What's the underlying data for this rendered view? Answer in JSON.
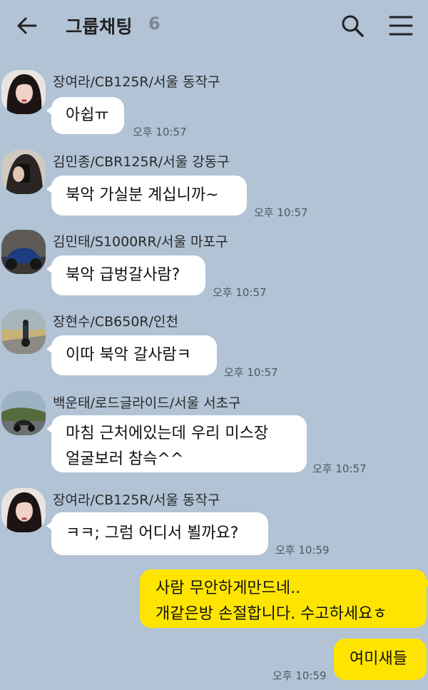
{
  "header": {
    "title": "그룹채팅",
    "member_count": "6",
    "back_icon": "back-arrow-icon",
    "search_icon": "search-icon",
    "menu_icon": "hamburger-menu-icon"
  },
  "colors": {
    "background": "#b1c3d5",
    "incoming_bubble": "#ffffff",
    "outgoing_bubble": "#fee501"
  },
  "messages": [
    {
      "sender": "장여라/CB125R/서울 동작구",
      "text": "아쉽ㅠ",
      "time": "오후 10:57"
    },
    {
      "sender": "김민종/CBR125R/서울 강동구",
      "text": "북악 가실분 계십니까~",
      "time": "오후 10:57"
    },
    {
      "sender": "김민태/S1000RR/서울 마포구",
      "text": "북악 급벙갈사람?",
      "time": "오후 10:57"
    },
    {
      "sender": "장현수/CB650R/인천",
      "text": "이따 북악 갈사람ㅋ",
      "time": "오후 10:57"
    },
    {
      "sender": "백운태/로드글라이드/서울 서초구",
      "line1": "마침 근처에있는데 우리 미스장",
      "line2": "얼굴보러 참슥^^",
      "time": "오후 10:57"
    },
    {
      "sender": "장여라/CB125R/서울 동작구",
      "text": "ㅋㅋ; 그럼 어디서 뵐까요?",
      "time": "오후 10:59"
    }
  ],
  "my_messages": [
    {
      "line1": "사람 무안하게만드네..",
      "line2": "개같은방 손절합니다. 수고하세요ㅎ"
    },
    {
      "text": "여미새들",
      "time": "오후 10:59"
    }
  ]
}
